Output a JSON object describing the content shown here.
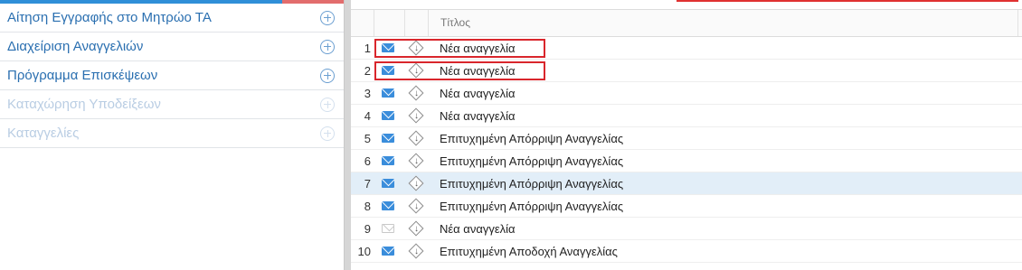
{
  "sidebar": {
    "items": [
      {
        "label": "Αίτηση Εγγραφής στο Μητρώο ΤΑ",
        "enabled": true
      },
      {
        "label": "Διαχείριση Αναγγελιών",
        "enabled": true
      },
      {
        "label": "Πρόγραμμα Επισκέψεων",
        "enabled": true
      },
      {
        "label": "Καταχώρηση Υποδείξεων",
        "enabled": false
      },
      {
        "label": "Καταγγελίες",
        "enabled": false
      }
    ],
    "item_icon": "plus-circle-icon"
  },
  "grid": {
    "columns": {
      "title": "Τίτλος"
    },
    "rows": [
      {
        "num": "1",
        "title": "Νέα αναγγελία",
        "mail": "unread"
      },
      {
        "num": "2",
        "title": "Νέα αναγγελία",
        "mail": "unread"
      },
      {
        "num": "3",
        "title": "Νέα αναγγελία",
        "mail": "unread"
      },
      {
        "num": "4",
        "title": "Νέα αναγγελία",
        "mail": "unread"
      },
      {
        "num": "5",
        "title": "Επιτυχημένη Απόρριψη Αναγγελίας",
        "mail": "unread"
      },
      {
        "num": "6",
        "title": "Επιτυχημένη Απόρριψη Αναγγελίας",
        "mail": "unread"
      },
      {
        "num": "7",
        "title": "Επιτυχημένη Απόρριψη Αναγγελίας",
        "mail": "unread"
      },
      {
        "num": "8",
        "title": "Επιτυχημένη Απόρριψη Αναγγελίας",
        "mail": "unread"
      },
      {
        "num": "9",
        "title": "Νέα αναγγελία",
        "mail": "read"
      },
      {
        "num": "10",
        "title": "Επιτυχημένη Αποδοχή Αναγγελίας",
        "mail": "unread"
      }
    ],
    "selected_row": "7",
    "highlighted_rows": [
      "1",
      "2"
    ]
  },
  "colors": {
    "link": "#2a6fb0",
    "accent_blue": "#2f8fd8",
    "highlight_red": "#d9262c",
    "selected_row": "#e2eef8"
  }
}
